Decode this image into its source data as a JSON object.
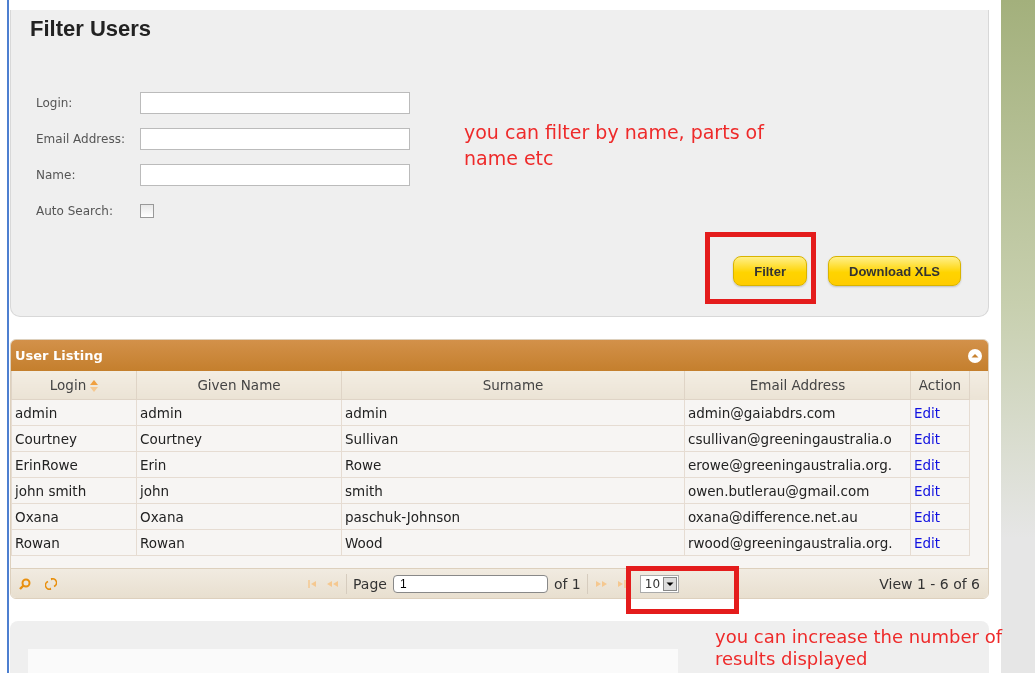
{
  "filter_panel": {
    "title": "Filter Users",
    "fields": [
      {
        "kind": "text",
        "label": "Login:"
      },
      {
        "kind": "text",
        "label": "Email Address:"
      },
      {
        "kind": "text",
        "label": "Name:"
      },
      {
        "kind": "checkbox",
        "label": "Auto Search:",
        "checked": false
      }
    ],
    "buttons": [
      "Filter",
      "Download XLS"
    ]
  },
  "annotations": [
    {
      "text": "you can filter by name, parts of name etc"
    },
    {
      "text": "you can increase the number of results displayed"
    }
  ],
  "user_listing": {
    "title": "User Listing",
    "columns": [
      {
        "label": "Login",
        "sorted": true
      },
      {
        "label": "Given Name",
        "sorted": false
      },
      {
        "label": "Surname",
        "sorted": false
      },
      {
        "label": "Email Address",
        "sorted": false
      },
      {
        "label": "Action",
        "sorted": false
      }
    ],
    "rows": [
      {
        "login": "admin",
        "given_name": "admin",
        "surname": "admin",
        "email": "admin@gaiabdrs.com",
        "action": "Edit"
      },
      {
        "login": "Courtney",
        "given_name": "Courtney",
        "surname": "Sullivan",
        "email": "csullivan@greeningaustralia.o",
        "action": "Edit"
      },
      {
        "login": "ErinRowe",
        "given_name": "Erin",
        "surname": "Rowe",
        "email": "erowe@greeningaustralia.org.",
        "action": "Edit"
      },
      {
        "login": "john smith",
        "given_name": "john",
        "surname": "smith",
        "email": "owen.butlerau@gmail.com",
        "action": "Edit"
      },
      {
        "login": "Oxana",
        "given_name": "Oxana",
        "surname": "paschuk-Johnson",
        "email": "oxana@difference.net.au",
        "action": "Edit"
      },
      {
        "login": "Rowan",
        "given_name": "Rowan",
        "surname": "Wood",
        "email": "rwood@greeningaustralia.org.",
        "action": "Edit"
      }
    ],
    "pager": {
      "page_label": "Page",
      "page_value": "1",
      "of_label": "of 1",
      "page_size": "10",
      "view_text": "View 1 - 6 of 6"
    }
  }
}
